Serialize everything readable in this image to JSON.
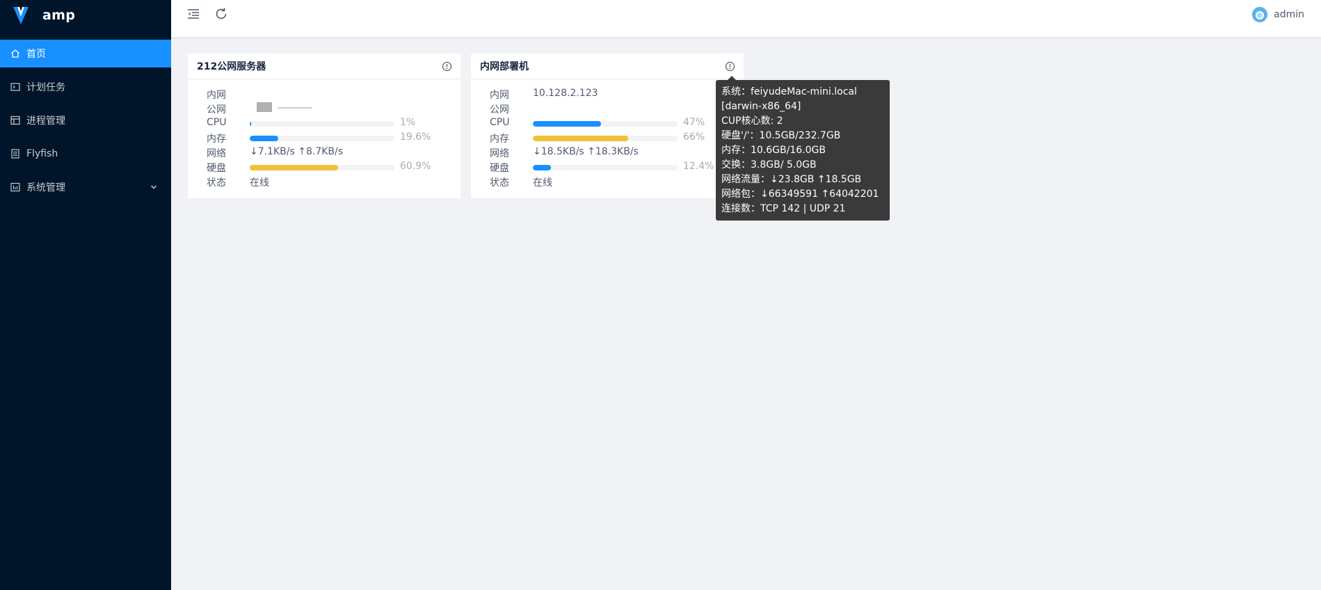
{
  "app": {
    "name": "amp"
  },
  "sidebar": {
    "items": [
      {
        "label": "首页",
        "icon": "home-icon",
        "active": true
      },
      {
        "label": "计划任务",
        "icon": "terminal-icon"
      },
      {
        "label": "进程管理",
        "icon": "process-icon"
      },
      {
        "label": "Flyfish",
        "icon": "document-icon"
      },
      {
        "label": "系统管理",
        "icon": "settings-grid-icon",
        "has_submenu": true
      }
    ]
  },
  "header": {
    "toggle_icon": "menu-fold-icon",
    "refresh_icon": "refresh-icon",
    "username": "admin"
  },
  "labels": {
    "intranet": "内网",
    "public": "公网",
    "cpu": "CPU",
    "memory": "内存",
    "network": "网络",
    "disk": "硬盘",
    "status": "状态"
  },
  "colors": {
    "sidebar_bg": "#001529",
    "accent": "#1890ff",
    "cpu_bar": "#1890ff",
    "memory_bar": "#1890ff",
    "disk_bar": "#f0c239",
    "online": "#19be6b"
  },
  "servers": [
    {
      "title": "212公网服务器",
      "intranet": "",
      "public": "",
      "cpu": {
        "percent": 1,
        "text": "1%"
      },
      "memory": {
        "percent": 19.6,
        "text": "19.6%",
        "color": "#1890ff"
      },
      "network": "↓7.1KB/s ↑8.7KB/s",
      "disk": {
        "percent": 60.9,
        "text": "60.9%",
        "color": "#f0c239"
      },
      "status": "在线"
    },
    {
      "title": "内网部署机",
      "intranet": "10.128.2.123",
      "public": "",
      "cpu": {
        "percent": 47,
        "text": "47%"
      },
      "memory": {
        "percent": 66,
        "text": "66%",
        "color": "#f0c239"
      },
      "network": "↓18.5KB/s ↑18.3KB/s",
      "disk": {
        "percent": 12.4,
        "text": "12.4%",
        "color": "#1890ff"
      },
      "status": "在线"
    }
  ],
  "tooltip": {
    "lines": [
      "系统：feiyudeMac-mini.local",
      "[darwin-x86_64]",
      "CUP核心数: 2",
      "硬盘'/'：10.5GB/232.7GB",
      "内存：10.6GB/16.0GB",
      "交换：3.8GB/ 5.0GB",
      "网络流量：↓23.8GB ↑18.5GB",
      "网络包：↓66349591 ↑64042201",
      "连接数：TCP 142 | UDP 21"
    ]
  }
}
